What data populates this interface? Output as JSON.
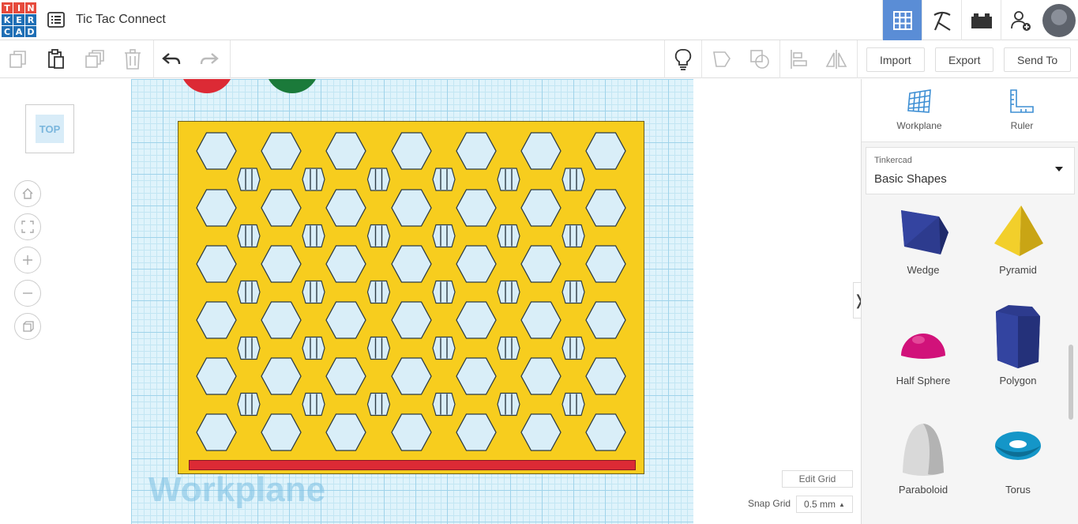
{
  "app": {
    "logo_letters": [
      "T",
      "I",
      "N",
      "K",
      "E",
      "R",
      "C",
      "A",
      "D"
    ],
    "logo_colors": [
      "#e64a3c",
      "#e64a3c",
      "#e64a3c",
      "#1f6fb5",
      "#1f6fb5",
      "#1f6fb5",
      "#1f6fb5",
      "#1f6fb5",
      "#1f6fb5"
    ],
    "title": "Tic Tac Connect"
  },
  "header_icons": {
    "design_view": "grid-view-icon",
    "tinker": "pickaxe-icon",
    "bricks": "brick-icon",
    "add_user": "add-user-icon",
    "avatar": "avatar"
  },
  "toolbar": {
    "copy": "copy-icon",
    "paste": "paste-icon",
    "duplicate": "duplicate-icon",
    "delete": "trash-icon",
    "undo": "undo-icon",
    "redo": "redo-icon",
    "notes": "lightbulb-icon",
    "import_label": "Import",
    "export_label": "Export",
    "sendto_label": "Send To"
  },
  "view": {
    "cube_face": "TOP",
    "nav": [
      "home-icon",
      "fit-icon",
      "zoom-in-icon",
      "zoom-out-icon",
      "perspective-icon"
    ]
  },
  "workplane": {
    "watermark": "Workplane",
    "edit_grid_label": "Edit Grid",
    "snap_grid_label": "Snap Grid",
    "snap_value": "0.5 mm",
    "accent_yellow": "#f7cd1e",
    "accent_red": "#dc2a35",
    "accent_green": "#1b7a3a"
  },
  "right_panel": {
    "workplane_label": "Workplane",
    "ruler_label": "Ruler",
    "library_source": "Tinkercad",
    "library_name": "Basic Shapes",
    "shapes": [
      {
        "label": "Wedge",
        "color": "#2d3b8e"
      },
      {
        "label": "Pyramid",
        "color": "#e8c21c"
      },
      {
        "label": "Half Sphere",
        "color": "#d1127a"
      },
      {
        "label": "Polygon",
        "color": "#2d3b8e"
      },
      {
        "label": "Paraboloid",
        "color": "#d9d9d9"
      },
      {
        "label": "Torus",
        "color": "#1496c8"
      }
    ]
  }
}
